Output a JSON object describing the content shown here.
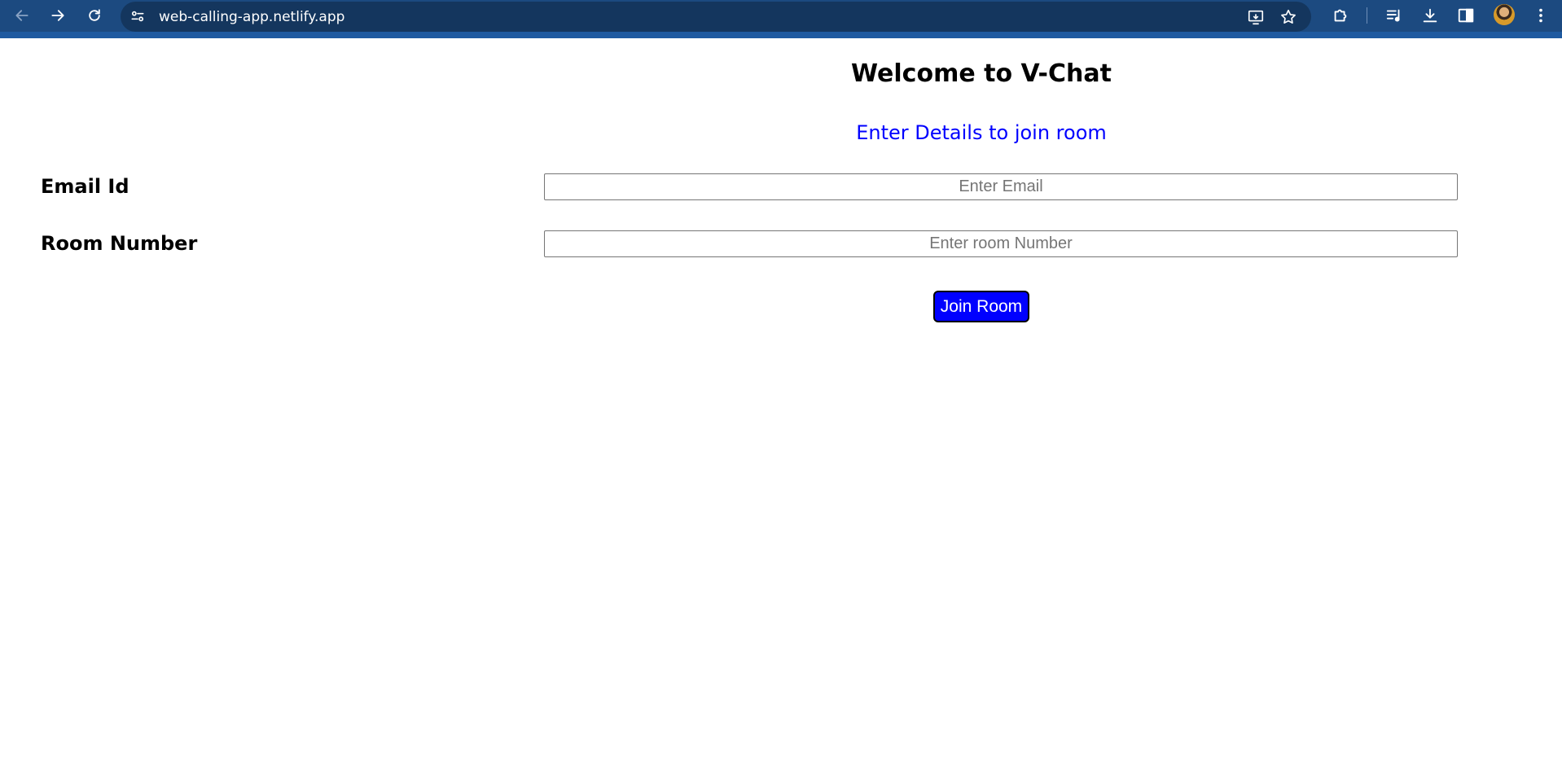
{
  "browser": {
    "url": "web-calling-app.netlify.app",
    "back_icon": "arrow-left-icon",
    "forward_icon": "arrow-right-icon",
    "reload_icon": "reload-icon",
    "site_info_icon": "tune-icon",
    "install_icon": "install-app-icon",
    "bookmark_icon": "star-icon",
    "extensions_icon": "puzzle-icon",
    "media_icon": "media-queue-icon",
    "download_icon": "download-icon",
    "sidepanel_icon": "side-panel-icon",
    "menu_icon": "kebab-menu-icon",
    "theme_color": "#1c4a80"
  },
  "page": {
    "title": "Welcome to V-Chat",
    "subtitle": "Enter Details to join room",
    "subtitle_color": "#0000ff",
    "email": {
      "label": "Email Id",
      "placeholder": "Enter Email",
      "value": ""
    },
    "room": {
      "label": "Room Number",
      "placeholder": "Enter room Number",
      "value": ""
    },
    "join_button": {
      "label": "Join Room",
      "color": "#0000ff"
    }
  }
}
